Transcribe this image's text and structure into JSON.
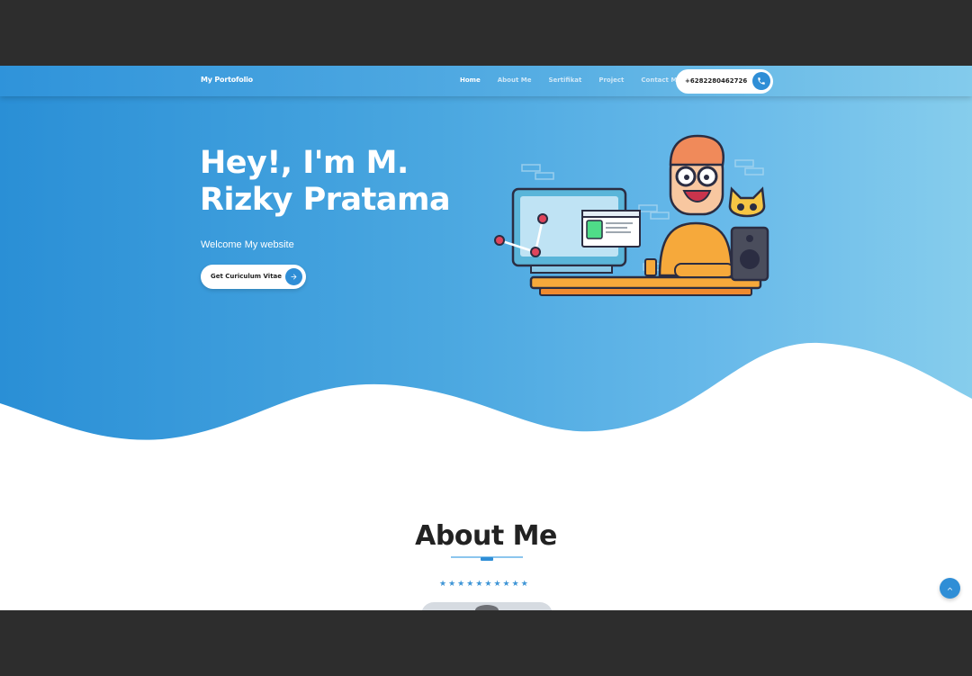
{
  "navbar": {
    "brand": "My Portofolio",
    "links": [
      "Home",
      "About Me",
      "Sertifikat",
      "Project",
      "Contact Me"
    ],
    "active_link": "Home",
    "phone": "+6282280462726"
  },
  "hero": {
    "title_line1": "Hey!, I'm M.",
    "title_line2": "Rizky Pratama",
    "subtitle": "Welcome My website",
    "cv_button": "Get Curiculum Vitae"
  },
  "about": {
    "title": "About Me",
    "stars": 10
  },
  "icons": {
    "phone": "phone-icon",
    "cv_arrow": "arrow-right-icon",
    "scroll_top": "chevron-up-icon",
    "stars": "star-icon"
  },
  "colors": {
    "accent": "#2f8ed6",
    "hero_start": "#2a8fd6",
    "hero_end": "#86cdec",
    "frame": "#2d2d2d"
  }
}
